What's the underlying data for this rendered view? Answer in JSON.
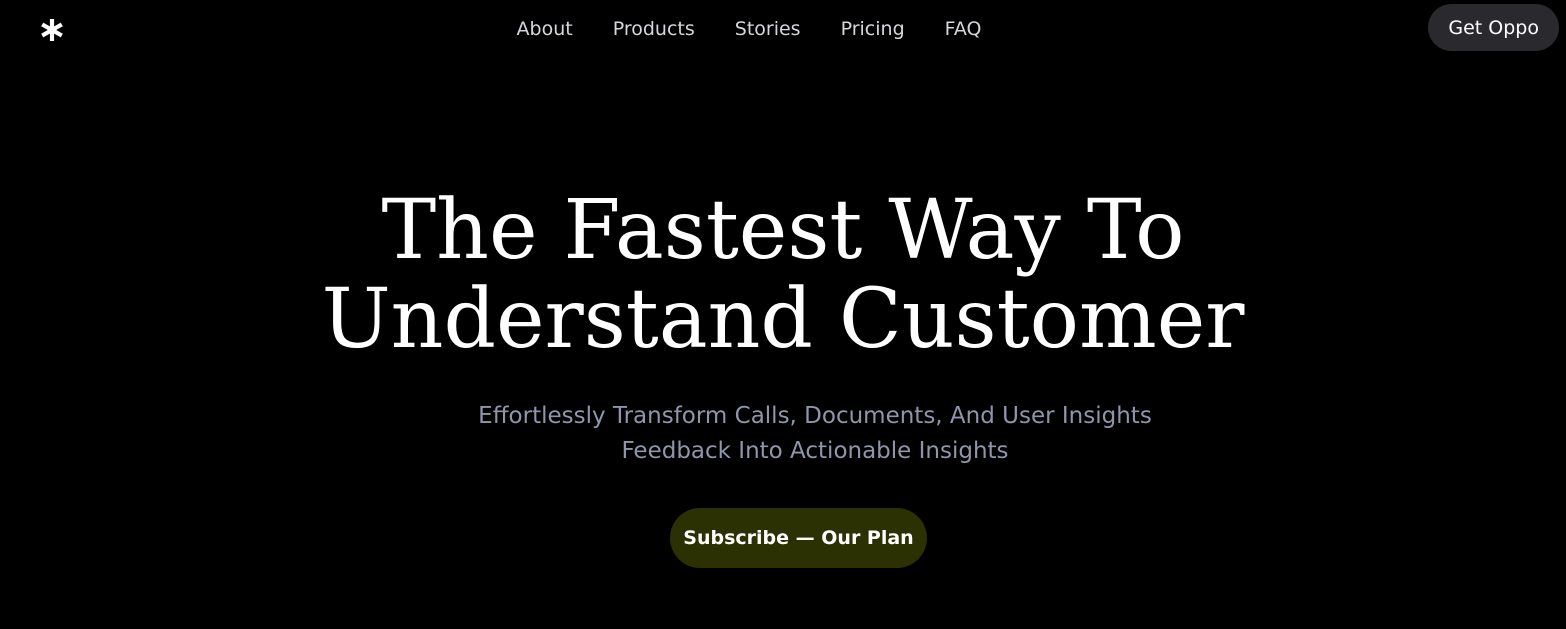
{
  "brand": {
    "logo_icon": "asterisk-icon"
  },
  "nav": {
    "items": [
      {
        "label": "About"
      },
      {
        "label": "Products"
      },
      {
        "label": "Stories"
      },
      {
        "label": "Pricing"
      },
      {
        "label": "FAQ"
      }
    ],
    "cta_label": "Get Oppo"
  },
  "hero": {
    "title_line1": "The Fastest Way To",
    "title_line2": "Understand Customer",
    "subtitle_line1": "Effortlessly Transform Calls, Documents, And User Insights",
    "subtitle_line2": "Feedback Into Actionable Insights",
    "button_label": "Subscribe — Our Plan"
  },
  "colors": {
    "background": "#000000",
    "nav_text": "#d6d6dc",
    "subtitle_text": "#8f96ac",
    "cta_top_bg": "#2a2a2e",
    "subscribe_bg": "#2c3103"
  }
}
